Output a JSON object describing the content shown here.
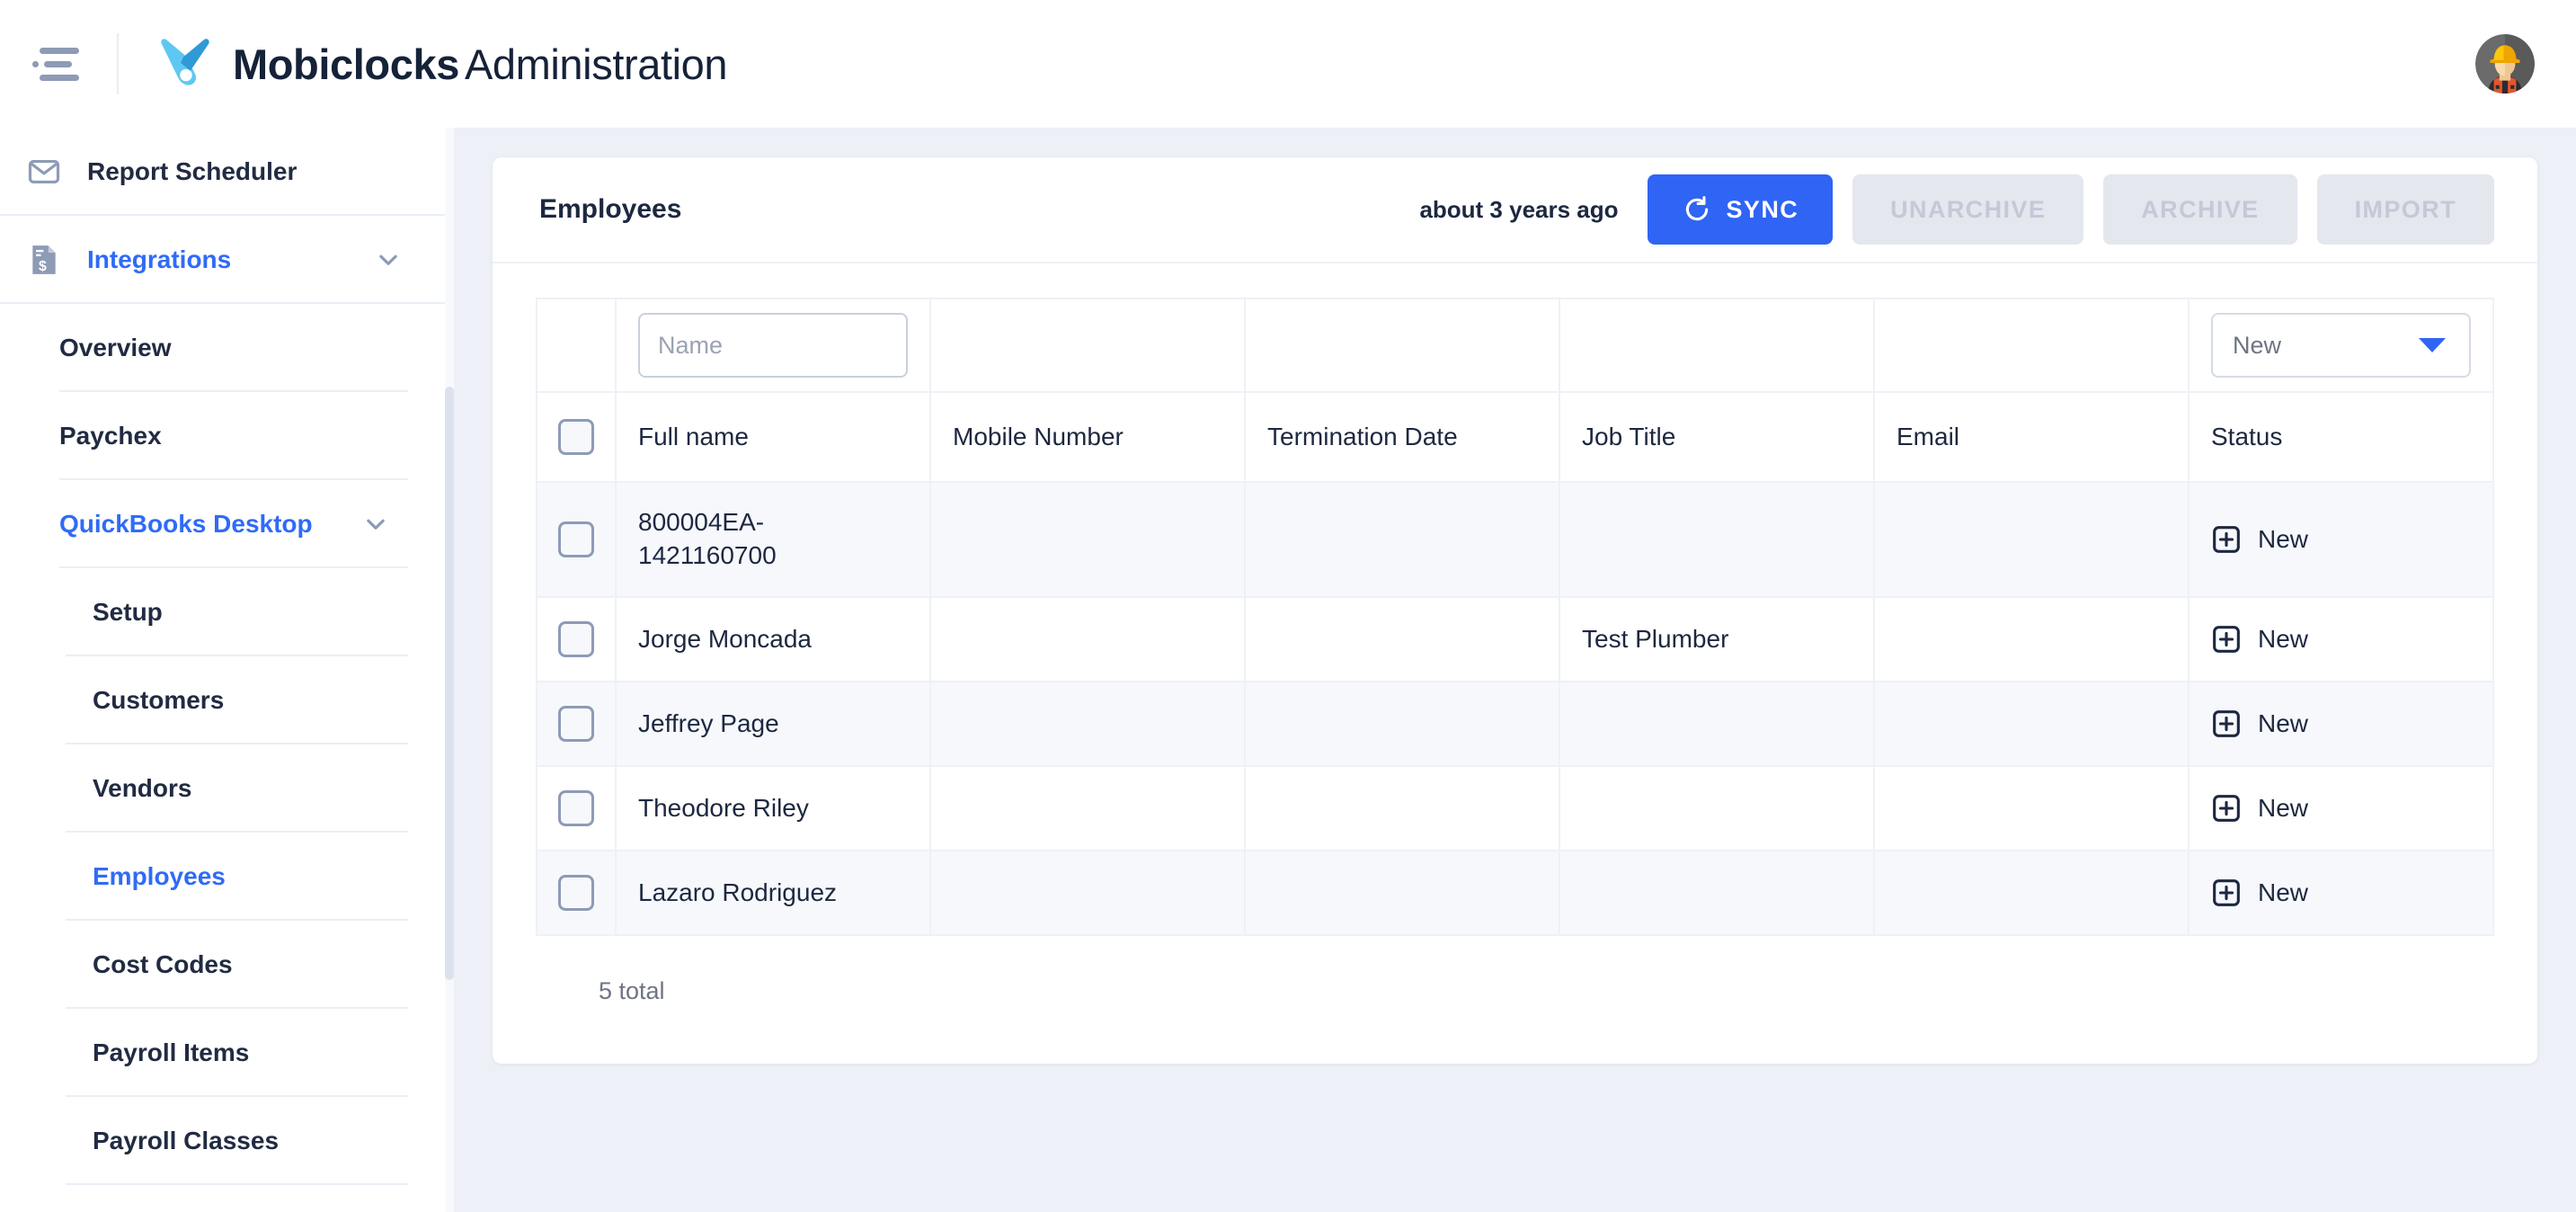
{
  "topbar": {
    "menu_icon": "hamburger-menu-icon",
    "logo_icon": "mobiclocks-v-logo",
    "brand_name": "Mobiclocks",
    "brand_suffix": "Administration",
    "avatar_icon": "construction-worker-avatar"
  },
  "colors": {
    "accent_blue": "#2f64f5",
    "link_blue": "#2f6bf7",
    "text_dark": "#1d2840",
    "muted": "#6e7482",
    "page_bg": "#edf0f7",
    "border": "#eef1f6",
    "disabled_bg": "#e4e7ee",
    "disabled_text": "#c3c9d6",
    "row_alt": "#f6f8fc"
  },
  "sidebar": {
    "items": [
      {
        "label": "Report Scheduler",
        "level": 0,
        "icon": "envelope-icon",
        "active": false,
        "chevron": false
      },
      {
        "label": "Integrations",
        "level": 0,
        "icon": "invoice-dollar-icon",
        "active": true,
        "chevron": true
      },
      {
        "label": "Overview",
        "level": 1,
        "icon": "",
        "active": false,
        "chevron": false
      },
      {
        "label": "Paychex",
        "level": 1,
        "icon": "",
        "active": false,
        "chevron": false
      },
      {
        "label": "QuickBooks Desktop",
        "level": 1,
        "icon": "",
        "active": true,
        "chevron": true
      },
      {
        "label": "Setup",
        "level": 2,
        "icon": "",
        "active": false,
        "chevron": false
      },
      {
        "label": "Customers",
        "level": 2,
        "icon": "",
        "active": false,
        "chevron": false
      },
      {
        "label": "Vendors",
        "level": 2,
        "icon": "",
        "active": false,
        "chevron": false
      },
      {
        "label": "Employees",
        "level": 2,
        "icon": "",
        "active": true,
        "chevron": false
      },
      {
        "label": "Cost Codes",
        "level": 2,
        "icon": "",
        "active": false,
        "chevron": false
      },
      {
        "label": "Payroll Items",
        "level": 2,
        "icon": "",
        "active": false,
        "chevron": false
      },
      {
        "label": "Payroll Classes",
        "level": 2,
        "icon": "",
        "active": false,
        "chevron": false
      }
    ]
  },
  "card": {
    "title": "Employees",
    "last_synced": "about 3 years ago",
    "buttons": {
      "sync": "SYNC",
      "sync_icon": "refresh-icon",
      "unarchive": "UNARCHIVE",
      "archive": "ARCHIVE",
      "import": "IMPORT"
    },
    "filters": {
      "name_placeholder": "Name",
      "name_value": "",
      "status_selected": "New"
    },
    "columns": [
      "Full name",
      "Mobile Number",
      "Termination Date",
      "Job Title",
      "Email",
      "Status"
    ],
    "rows": [
      {
        "full_name": "800004EA-\n1421160700",
        "mobile": "",
        "termination": "",
        "job_title": "",
        "email": "",
        "status": "New",
        "status_icon": "plus-square-icon"
      },
      {
        "full_name": "Jorge Moncada",
        "mobile": "",
        "termination": "",
        "job_title": "Test Plumber",
        "email": "",
        "status": "New",
        "status_icon": "plus-square-icon"
      },
      {
        "full_name": "Jeffrey Page",
        "mobile": "",
        "termination": "",
        "job_title": "",
        "email": "",
        "status": "New",
        "status_icon": "plus-square-icon"
      },
      {
        "full_name": "Theodore Riley",
        "mobile": "",
        "termination": "",
        "job_title": "",
        "email": "",
        "status": "New",
        "status_icon": "plus-square-icon"
      },
      {
        "full_name": "Lazaro Rodriguez",
        "mobile": "",
        "termination": "",
        "job_title": "",
        "email": "",
        "status": "New",
        "status_icon": "plus-square-icon"
      }
    ],
    "total_label": "5 total"
  }
}
